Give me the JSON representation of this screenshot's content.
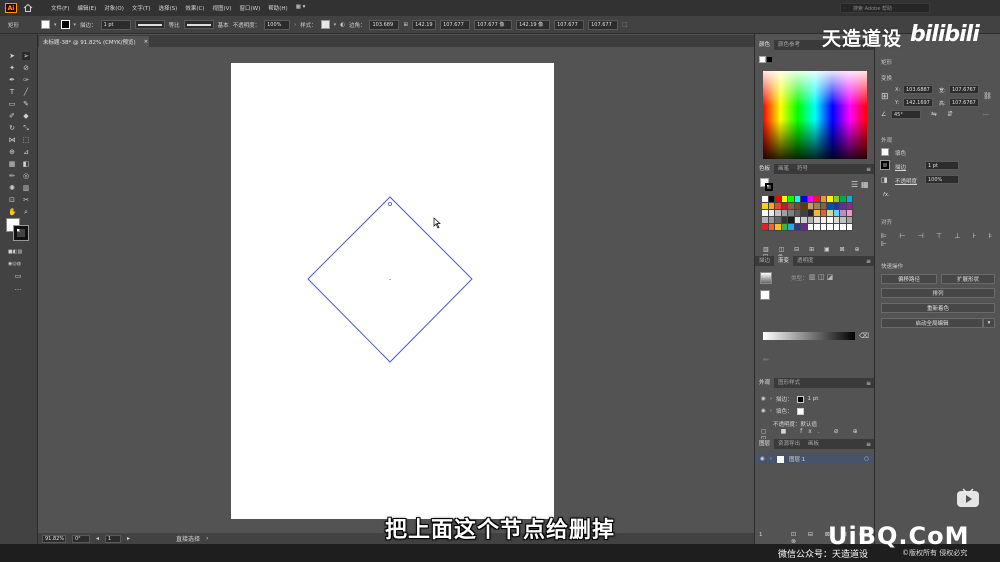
{
  "menu": {
    "items": [
      "文件(F)",
      "编辑(E)",
      "对象(O)",
      "文字(T)",
      "选择(S)",
      "效果(C)",
      "视图(V)",
      "窗口(W)",
      "帮助(H)"
    ],
    "search_placeholder": "搜索 Adobe 帮助"
  },
  "control": {
    "selection_type": "矩形",
    "stroke_label": "描边：",
    "stroke_weight": "1 pt",
    "profile_label": "等比",
    "brush_label": "基本",
    "opacity_label": "不透明度：",
    "opacity_value": "100%",
    "style_label": "样式：",
    "shape_label": "边角：",
    "corner_value": "103.689",
    "x_value": "142.19",
    "y_value": "107.677",
    "w_value": "107.677 像",
    "h_value": "142.19 像",
    "h2_value": "107.677",
    "h3_value": "107.677"
  },
  "document": {
    "tab_title": "未标题-38* @ 91.82% (CMYK/预览)",
    "close_glyph": "×"
  },
  "status": {
    "zoom": "91.82%",
    "angle": "0°",
    "page": "1",
    "tool_name": "直接选择"
  },
  "color_panel": {
    "tabs": [
      "颜色",
      "颜色参考"
    ]
  },
  "swatch_panel": {
    "tabs": [
      "色板",
      "画笔",
      "符号"
    ],
    "colors": [
      [
        "#ffffff",
        "#000000",
        "#ff0000",
        "#ffff00",
        "#00ff00",
        "#00ffff",
        "#0000ff",
        "#ff00ff",
        "#ed1c24",
        "#f7941d",
        "#fff200",
        "#8dc63f",
        "#00a651",
        "#00aeef"
      ],
      [
        "#f7d117",
        "#faa61a",
        "#ef4136",
        "#be1e2d",
        "#8b5e3c",
        "#754c24",
        "#603913",
        "#c69c6d",
        "#a67c52",
        "#8c6239",
        "#0054a6",
        "#2e3192",
        "#662d91",
        "#92278f"
      ],
      [
        "#ffffff",
        "#ebebeb",
        "#c2c2c2",
        "#a0a0a0",
        "#808080",
        "#5e5e5e",
        "#404040",
        "#262626",
        "#fbb040",
        "#f15a29",
        "#c4df9b",
        "#6dcff6",
        "#bd8cbf",
        "#f49ac1"
      ],
      [
        "#b3b3b3",
        "#999999",
        "#666666",
        "#333333",
        "#1a1a1a",
        "#e6e6e6",
        "#cccccc",
        "#b3b3b3",
        "#e0e0e0",
        "#f2f2f2",
        "#ffffff",
        "#d9d9d9",
        "#bfbfbf",
        "#a6a6a6"
      ],
      [
        "#ed1c24",
        "#f26522",
        "#ffc20e",
        "#39b54a",
        "#27aae1",
        "#2b3990",
        "#662d91",
        "#ffffff",
        "#ffffff",
        "#ffffff",
        "#ffffff",
        "#ffffff",
        "#ffffff",
        "#ffffff"
      ]
    ]
  },
  "stroke_panel": {
    "tabs": [
      "描边",
      "渐变",
      "透明度"
    ],
    "type_label": "类型："
  },
  "appearance_panel": {
    "tabs": [
      "外观",
      "图形样式"
    ],
    "rows": [
      {
        "label": "描边：",
        "value": "1 pt"
      },
      {
        "label": "填色：",
        "value": ""
      },
      {
        "label": "不透明度：默认值",
        "value": ""
      }
    ]
  },
  "layers_panel": {
    "tabs": [
      "图层",
      "资源导出",
      "画板"
    ],
    "layer_name": "图层 1"
  },
  "properties": {
    "section_shape": "矩形",
    "section_transform": "变换",
    "x_label": "X:",
    "x_value": "103.6887",
    "y_label": "Y:",
    "y_value": "142.1697",
    "w_label": "宽:",
    "w_value": "107.6767",
    "h_label": "高:",
    "h_value": "107.6767",
    "angle_value": "45°",
    "section_appearance": "外观",
    "fill_label": "填色",
    "stroke_label": "描边",
    "stroke_value": "1 pt",
    "opacity_label": "不透明度",
    "opacity_value": "100%",
    "fx_label": "fx.",
    "section_align": "对齐",
    "section_quick": "快速操作",
    "btn_offset": "偏移路径",
    "btn_expand": "扩展形状",
    "btn_arrange": "排列",
    "btn_recolor": "重新着色",
    "btn_global_edit": "启动全局编辑"
  },
  "overlay": {
    "brand_name": "天造道设",
    "bili_logo": "bilibili",
    "subtitle": "把上面这个节点给删掉",
    "site_logo": "UiBQ.CoM",
    "wechat": "微信公众号：天造道设",
    "copyright": "©版权所有 侵权必究"
  },
  "colors": {
    "path_stroke": "#4a5bc4",
    "ui_dark": "#323232",
    "ui_panel": "#535353",
    "accent_orange": "#ff9a00"
  }
}
